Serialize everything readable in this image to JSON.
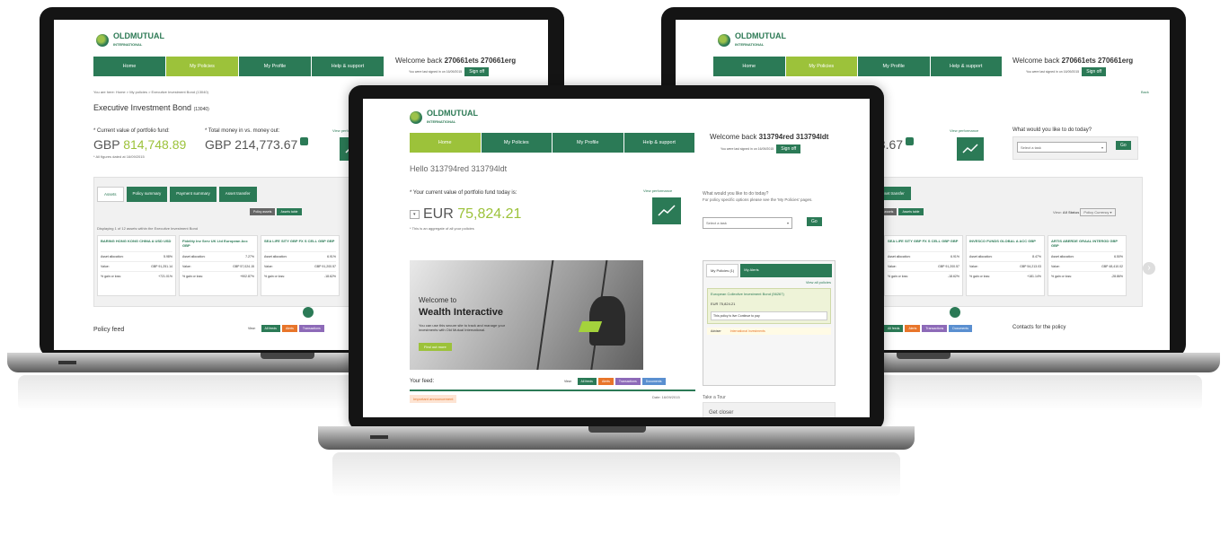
{
  "brand": {
    "line1": "OLDMUTUAL",
    "line2": "INTERNATIONAL"
  },
  "left": {
    "nav": [
      "Home",
      "My Policies",
      "My Profile",
      "Help & support"
    ],
    "welcome_prefix": "Welcome back",
    "user": "270661ets 270661erg",
    "last_signed": "You were last signed in on 16/09/2015",
    "signoff": "Sign off",
    "breadcrumb": "You are here: Home > My policies > Executive Investment Bond (13040)",
    "title": "Executive Investment Bond",
    "title_id": "(13040)",
    "current_label": "* Current value of portfolio fund:",
    "current_ccy": "GBP",
    "current_value": "814,748.89",
    "total_label": "* Total money in vs. money out:",
    "total_value": "GBP 214,773.67",
    "asof": "* All figures dated at 16/09/2015",
    "view_perf": "View performance",
    "tabs": [
      "Assets",
      "Policy summary",
      "Payment summary",
      "Asset transfer"
    ],
    "subtabs": [
      "Policy assets",
      "Assets table"
    ],
    "displaying": "Displaying 1 of 12 assets within the Executive Investment Bond",
    "cards": [
      {
        "title": "BARING HONG KONG CHINA A USD USD",
        "alloc": "5.98%",
        "value": "GBP 91,251.14",
        "gain": "+721.01%"
      },
      {
        "title": "Fidelity Inv Serv UK Ltd European Acc GBP",
        "alloc": "7.27%",
        "value": "GBP 57,024.15",
        "gain": "+902.87%"
      },
      {
        "title": "SEA LIFE SITY GBP FX S CELL GBP GBP",
        "alloc": "6.91%",
        "value": "GBP 91,200.57",
        "gain": "-18.62%"
      }
    ],
    "row_labels": [
      "Asset allocation:",
      "Value:",
      "% gain or loss:"
    ],
    "policy_feed": "Policy feed",
    "feed_btns": [
      "View:",
      "All feeds",
      "Alerts",
      "Transactions"
    ]
  },
  "right": {
    "nav": [
      "Home",
      "My Policies",
      "My Profile",
      "Help & support"
    ],
    "welcome_prefix": "Welcome back",
    "user": "270661ets 270661erg",
    "last_signed": "You were last signed in on 16/09/2015",
    "signoff": "Sign off",
    "back": "Back",
    "total_value": "73.67",
    "view_perf": "View performance",
    "question": "What would you like to do today?",
    "select": "Select a task",
    "go": "Go",
    "tab": "Asset transfer",
    "subtabs": [
      "Policy assets",
      "Assets table"
    ],
    "view_label": "View:",
    "all_status": "All Status",
    "policy_currency": "Policy Currency",
    "cards": [
      {
        "title": "SEA LIFE SITY GBP FX S CELL GBP GBP",
        "alloc": "6.91%",
        "value": "GBP 91,200.57",
        "gain": "-18.62%"
      },
      {
        "title": "INVESCO FUNDS GLOBAL A ACC GBP",
        "alloc": "8.47%",
        "value": "GBP 54,213.03",
        "gain": "+181.14%"
      },
      {
        "title": "ARTIS ABERDE GRAAL INTERGD GBP GBP",
        "alloc": "6.50%",
        "value": "GBP 48,410.02",
        "gain": "-28.86%"
      }
    ],
    "row_labels": [
      "Asset allocation:",
      "Value:",
      "% gain or loss:"
    ],
    "feed_btns": [
      "All feeds",
      "Alerts",
      "Transactions",
      "Documents"
    ],
    "contacts": "Contacts for the policy"
  },
  "center": {
    "nav": [
      "Home",
      "My Policies",
      "My Profile",
      "Help & support"
    ],
    "welcome_prefix": "Welcome back",
    "user": "313794red 313794ldt",
    "last_signed": "You were last signed in on 16/09/2015",
    "signoff": "Sign off",
    "hello": "Hello 313794red 313794ldt",
    "current_label": "* Your current value of portfolio fund today is:",
    "view_perf": "View performance",
    "currency": "EUR",
    "value": "75,824.21",
    "aggregate": "* This is an aggregate of all your policies",
    "question": "What would you like to do today?",
    "question_sub": "For policy specific options please see the 'My Policies' pages.",
    "select": "Select a task",
    "go": "Go",
    "hero_welcome": "Welcome to",
    "hero_title": "Wealth Interactive",
    "hero_text": "You can use this secure site to track and manage your investments with Old Mutual International.",
    "hero_btn": "Find out more",
    "policies_tab": "My Policies (1)",
    "alerts_tab": "My Alerts",
    "view_all": "View all policies",
    "policy_name": "European Collective Investment Bond (56267)",
    "policy_value": "EUR 75,824.21",
    "policy_status": "This policy is live  Continue to pay",
    "adviser": "Adviser",
    "adviser_name": "International Investments",
    "take_tour": "Take a Tour",
    "tour_text": "Get closer",
    "your_feed": "Your feed:",
    "feed_btns": [
      "View:",
      "All feeds",
      "Alerts",
      "Transactions",
      "Documents"
    ],
    "announce": "Important announcement",
    "feed_date": "Date: 16/09/2015"
  }
}
